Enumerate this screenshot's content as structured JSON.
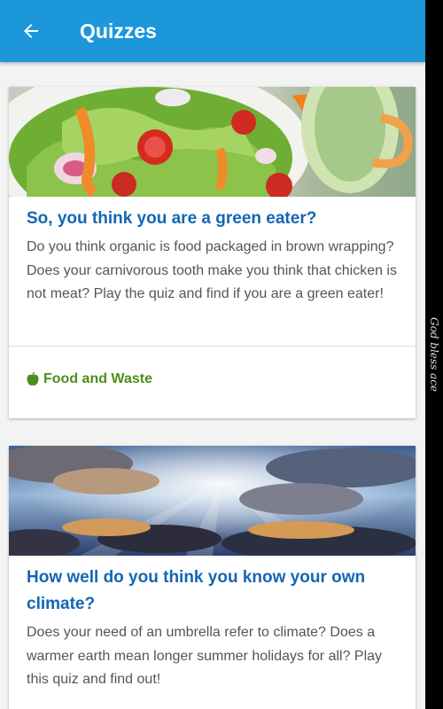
{
  "appbar": {
    "title": "Quizzes"
  },
  "quizzes": [
    {
      "title": "So, you think you are a green eater?",
      "description": "Do you think organic is food packaged in brown wrapping? Does your carnivorous tooth make you think that chicken is not meat? Play the quiz and find if you are a green eater!",
      "category": "Food and Waste"
    },
    {
      "title": "How well do you think you know your own climate?",
      "description": "Does your need of an umbrella refer to climate? Does a warmer earth mean longer summer holidays for all? Play this quiz and find out!"
    }
  ],
  "side_caption": "God bless ace",
  "colors": {
    "appbar": "#1b97da",
    "card_title": "#1466b3",
    "category": "#4b8e1b"
  }
}
